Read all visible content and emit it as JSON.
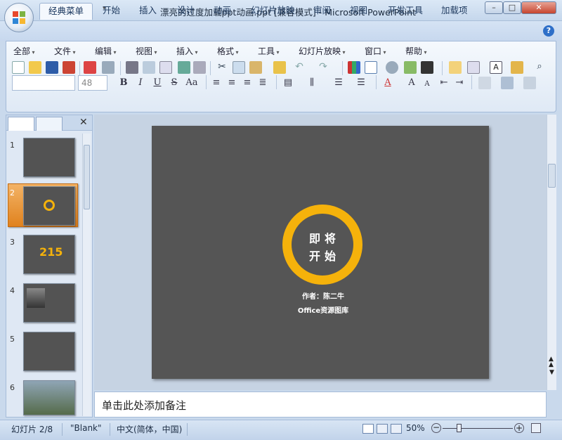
{
  "window": {
    "title": "漂亮的过度加载ppt动画.ppt [兼容模式] - Microsoft PowerPoint",
    "minimize": "–",
    "maximize": "□",
    "close": "✕"
  },
  "tabs": [
    "经典菜单",
    "开始",
    "插入",
    "设计",
    "动画",
    "幻灯片放映",
    "审阅",
    "视图",
    "开发工具",
    "加载项"
  ],
  "active_tab": "经典菜单",
  "menus": [
    "全部",
    "文件",
    "编辑",
    "视图",
    "插入",
    "格式",
    "工具",
    "幻灯片放映",
    "窗口",
    "帮助"
  ],
  "font_size_value": "48",
  "format_buttons": [
    "B",
    "I",
    "U",
    "S",
    "Aa"
  ],
  "panel": {
    "slide_numbers": [
      "1",
      "2",
      "3",
      "4",
      "5",
      "6"
    ],
    "selected_slide": "2",
    "thumb3_number": "215"
  },
  "slide": {
    "line1": "即将",
    "line2": "开始",
    "author": "作者：陈二牛",
    "org": "Office资源图库",
    "ring_color": "#f5b20b",
    "bg_color": "#555555"
  },
  "notes_placeholder": "单击此处添加备注",
  "status": {
    "slide_info": "幻灯片 2/8",
    "theme": "\"Blank\"",
    "language": "中文(简体，中国)",
    "zoom": "50%"
  }
}
